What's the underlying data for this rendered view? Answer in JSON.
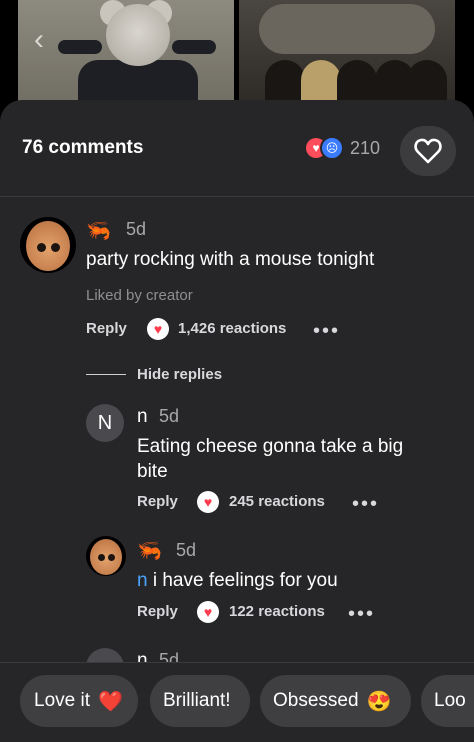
{
  "header": {
    "comment_count": "76 comments",
    "reaction_count": "210"
  },
  "comments": [
    {
      "time": "5d",
      "text": "party rocking with a mouse tonight",
      "liked_by": "Liked by creator",
      "reply_label": "Reply",
      "reactions": "1,426 reactions"
    }
  ],
  "hide_replies": "Hide replies",
  "replies": [
    {
      "avatar_letter": "N",
      "username": "n",
      "time": "5d",
      "text": "Eating cheese gonna take a big bite",
      "reply_label": "Reply",
      "reactions": "245 reactions"
    },
    {
      "time": "5d",
      "mention": "n",
      "text": " i have feelings for you",
      "reply_label": "Reply",
      "reactions": "122 reactions"
    },
    {
      "username": "n",
      "time": "5d"
    }
  ],
  "quick_reactions": [
    {
      "label": "Love it",
      "emoji": "❤️"
    },
    {
      "label": "Brilliant!",
      "emoji": ""
    },
    {
      "label": "Obsessed",
      "emoji": "😍"
    },
    {
      "label": "Loo",
      "emoji": ""
    }
  ],
  "icons": {
    "back": "chevron-left-icon",
    "like": "heart-outline-icon",
    "heart_reaction": "heart-emoji-icon",
    "sad_reaction": "sad-face-icon",
    "more": "more-dots-icon",
    "shrimp": "shrimp-emoji-icon"
  },
  "colors": {
    "sheet_bg": "#262628",
    "mention": "#4aa3ff",
    "heart": "#ff3b4e"
  }
}
